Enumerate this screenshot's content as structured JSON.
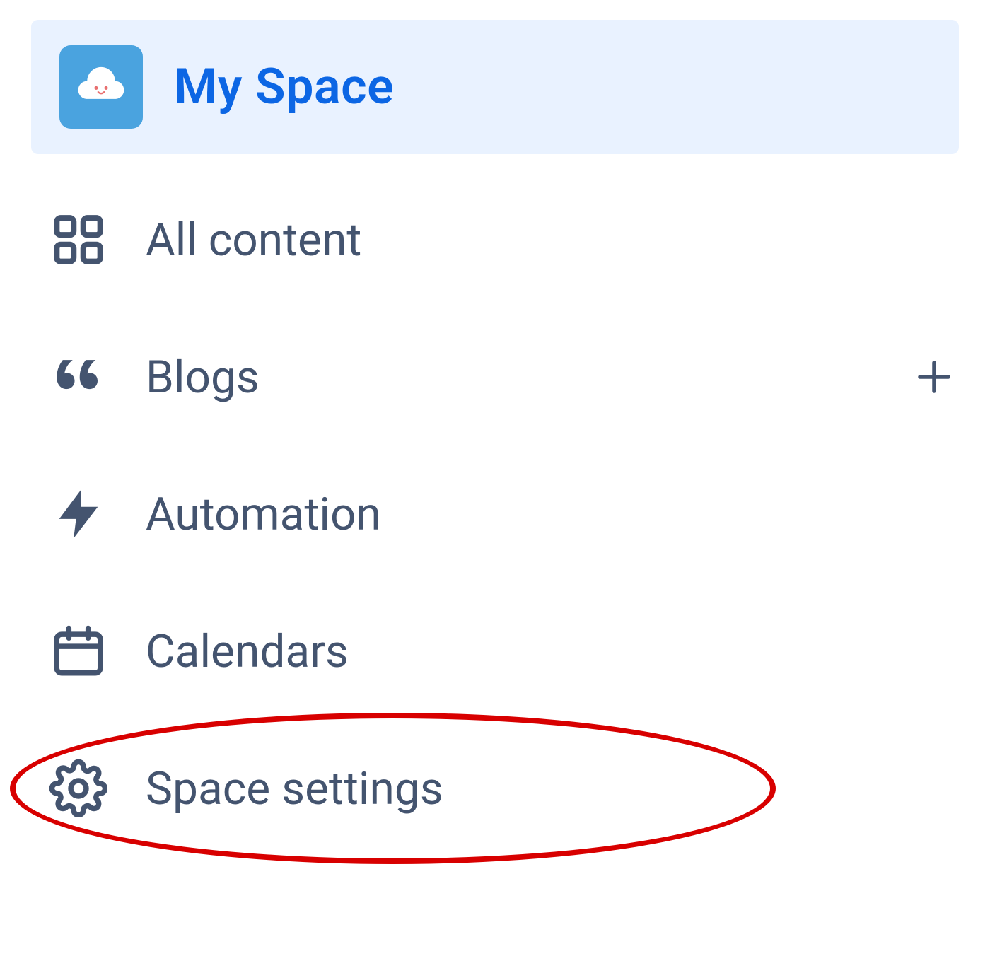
{
  "header": {
    "title": "My Space",
    "accent_color": "#0c66e4",
    "header_bg": "#e9f2ff",
    "logo_bg": "#4aa3df"
  },
  "nav": {
    "items": [
      {
        "id": "all-content",
        "label": "All content",
        "icon": "grid-icon",
        "has_add": false
      },
      {
        "id": "blogs",
        "label": "Blogs",
        "icon": "quote-icon",
        "has_add": true
      },
      {
        "id": "automation",
        "label": "Automation",
        "icon": "bolt-icon",
        "has_add": false
      },
      {
        "id": "calendars",
        "label": "Calendars",
        "icon": "calendar-icon",
        "has_add": false
      },
      {
        "id": "space-settings",
        "label": "Space settings",
        "icon": "gear-icon",
        "has_add": false
      }
    ]
  },
  "icon_text_color": "#44546f",
  "annotation": {
    "target": "space-settings",
    "color": "#d80000"
  }
}
